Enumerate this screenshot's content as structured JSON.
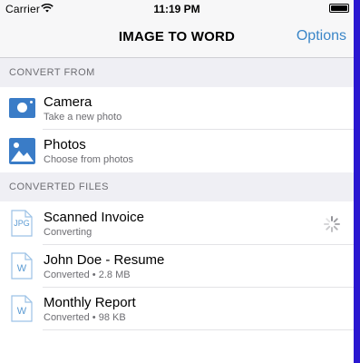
{
  "status_bar": {
    "carrier": "Carrier",
    "time": "11:19 PM",
    "battery_level": 1.0
  },
  "nav": {
    "title": "IMAGE TO WORD",
    "options_label": "Options"
  },
  "convert_from": {
    "header": "CONVERT FROM",
    "items": [
      {
        "title": "Camera",
        "subtitle": "Take a new photo",
        "icon": "camera-icon"
      },
      {
        "title": "Photos",
        "subtitle": "Choose from photos",
        "icon": "photos-icon"
      }
    ]
  },
  "converted_files": {
    "header": "CONVERTED FILES",
    "items": [
      {
        "title": "Scanned Invoice",
        "subtitle": "Converting",
        "icon": "jpg-file-icon",
        "file_label": "JPG",
        "loading": true
      },
      {
        "title": "John Doe - Resume",
        "subtitle": "Converted • 2.8 MB",
        "icon": "word-file-icon",
        "file_label": "W",
        "loading": false
      },
      {
        "title": "Monthly Report",
        "subtitle": "Converted • 98 KB",
        "icon": "word-file-icon",
        "file_label": "W",
        "loading": false
      }
    ]
  },
  "colors": {
    "accent": "#3a86c8",
    "icon_blue": "#3a7cc7",
    "section_bg": "#efeff4",
    "rail": "#2a17d1"
  }
}
